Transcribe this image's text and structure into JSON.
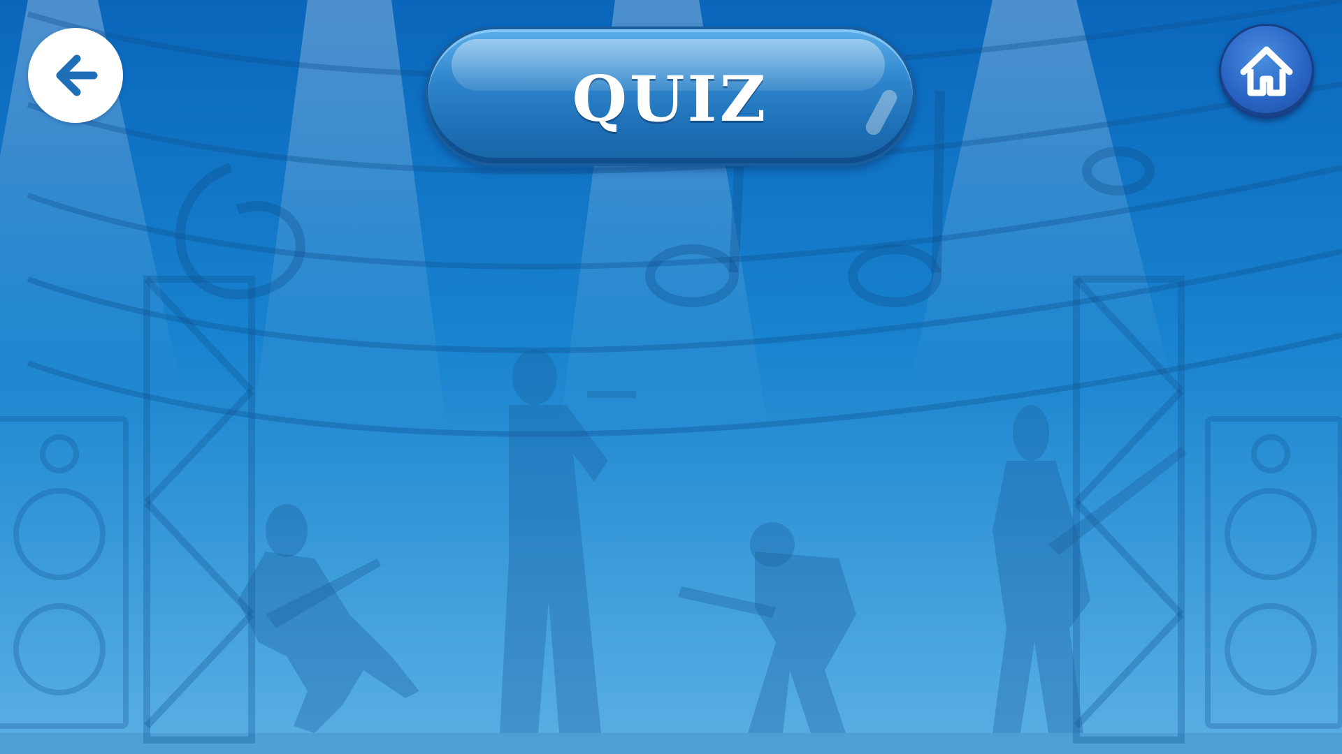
{
  "header": {
    "title": "QUIZ"
  },
  "navigation": {
    "back_icon": "arrow-left-icon",
    "home_icon": "home-icon"
  },
  "colors": {
    "background_top": "#0a6cc0",
    "background_bottom": "#56aee3",
    "title_pill": "#2f86cc",
    "home_button": "#2a65c4",
    "back_button": "#ffffff"
  }
}
